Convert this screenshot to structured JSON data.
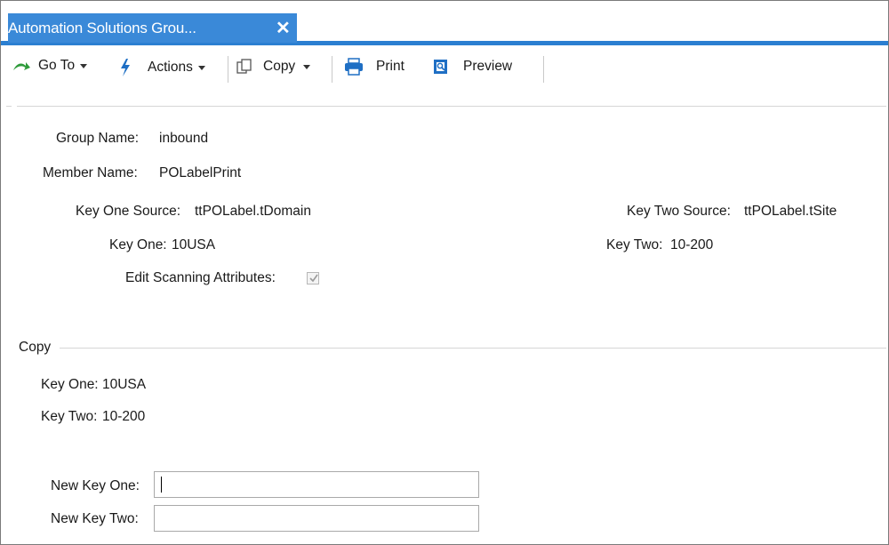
{
  "tab": {
    "title": "Automation Solutions Grou...",
    "close": "✕"
  },
  "toolbar": {
    "goto": "Go To",
    "actions": "Actions",
    "copy": "Copy",
    "print": "Print",
    "preview": "Preview"
  },
  "fields": {
    "group_name_label": "Group Name:",
    "group_name_value": "inbound",
    "member_name_label": "Member Name:",
    "member_name_value": "POLabelPrint",
    "key_one_source_label": "Key One Source:",
    "key_one_source_value": "ttPOLabel.tDomain",
    "key_two_source_label": "Key Two Source:",
    "key_two_source_value": "ttPOLabel.tSite",
    "key_one_label": "Key One:",
    "key_one_value": "10USA",
    "key_two_label": "Key Two:",
    "key_two_value": "10-200",
    "edit_scanning_label": "Edit Scanning Attributes:",
    "edit_scanning_checked": true
  },
  "copy_section": {
    "title": "Copy",
    "key_one_label": "Key One:",
    "key_one_value": "10USA",
    "key_two_label": "Key Two:",
    "key_two_value": "10-200",
    "new_key_one_label": "New Key One:",
    "new_key_one_value": "",
    "new_key_two_label": "New Key Two:",
    "new_key_two_value": ""
  },
  "colors": {
    "accent": "#3a89d8",
    "icon_green": "#2e9b3a",
    "icon_blue": "#1f6fc4"
  }
}
